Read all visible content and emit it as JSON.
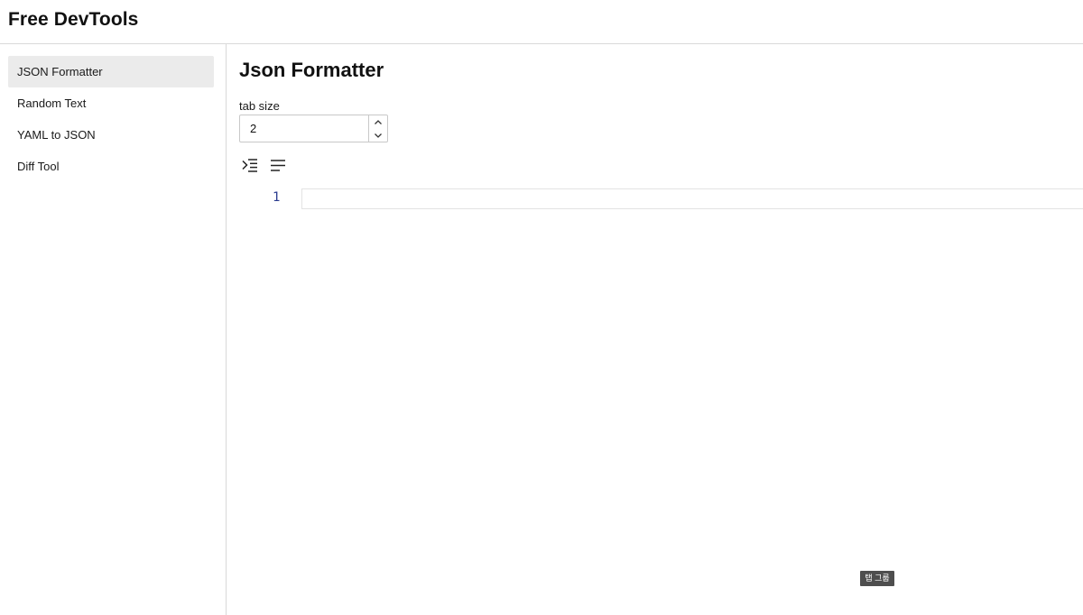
{
  "app": {
    "title": "Free DevTools"
  },
  "sidebar": {
    "items": [
      {
        "label": "JSON Formatter",
        "active": true
      },
      {
        "label": "Random Text",
        "active": false
      },
      {
        "label": "YAML to JSON",
        "active": false
      },
      {
        "label": "Diff Tool",
        "active": false
      }
    ]
  },
  "main": {
    "title": "Json Formatter",
    "tab_size": {
      "label": "tab size",
      "value": "2"
    },
    "toolbar": {
      "icons": [
        "indent-format-icon",
        "text-align-left-icon"
      ]
    },
    "editor": {
      "lines": [
        {
          "number": "1",
          "text": ""
        }
      ]
    }
  },
  "tooltip": {
    "text": "탭 그룹"
  },
  "colors": {
    "active_nav_bg": "#ebebeb",
    "line_number": "#2a3b8f",
    "tooltip_bg": "#4e4e4e"
  }
}
